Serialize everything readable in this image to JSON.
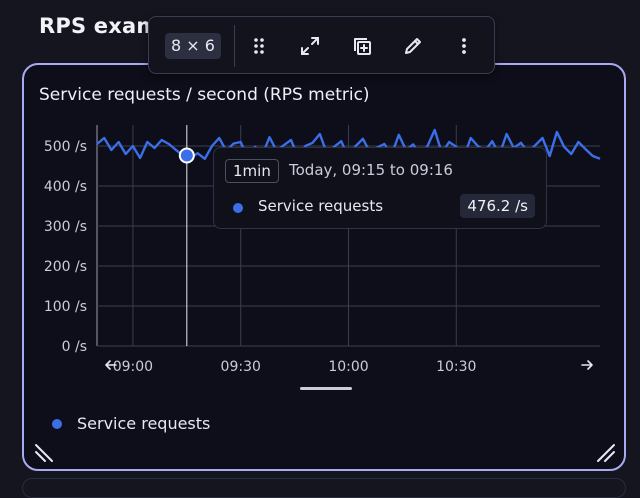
{
  "page": {
    "title": "RPS exam"
  },
  "toolbar": {
    "size": "8 × 6",
    "icons": [
      "drag-handle-icon",
      "expand-icon",
      "duplicate-icon",
      "edit-icon",
      "more-vertical-icon"
    ]
  },
  "tile": {
    "title": "Service requests / second (RPS metric)",
    "legend": {
      "label": "Service requests",
      "color": "#3a6fe8"
    }
  },
  "tooltip": {
    "interval": "1min",
    "time": "Today, 09:15 to 09:16",
    "series": "Service requests",
    "value": "476.2 /s"
  },
  "colors": {
    "series": "#3a6fe8",
    "accent_border": "#a9abf0",
    "background": "#0d0e19"
  },
  "chart_data": {
    "type": "line",
    "ylim": [
      0,
      500
    ],
    "y_ticks": [
      "500 /s",
      "400 /s",
      "300 /s",
      "200 /s",
      "100 /s",
      "0 /s"
    ],
    "y_tick_values": [
      500,
      400,
      300,
      200,
      100,
      0
    ],
    "x_ticks": [
      "09:00",
      "09:30",
      "10:00",
      "10:30"
    ],
    "x_tick_minutes": [
      540,
      570,
      600,
      630
    ],
    "x_range_minutes": [
      530,
      670
    ],
    "series": [
      {
        "color": "#3a6fe8",
        "x": [
          530,
          532,
          534,
          536,
          538,
          540,
          542,
          544,
          546,
          548,
          550,
          552,
          554,
          556,
          558,
          560,
          562,
          564,
          566,
          568,
          570,
          572,
          574,
          576,
          578,
          580,
          582,
          584,
          586,
          588,
          590,
          592,
          594,
          596,
          598,
          600,
          602,
          604,
          606,
          608,
          610,
          612,
          614,
          616,
          618,
          620,
          622,
          624,
          626,
          628,
          630,
          632,
          634,
          636,
          638,
          640,
          642,
          644,
          646,
          648,
          650,
          652,
          654,
          656,
          658,
          660,
          662,
          664,
          666,
          668,
          670
        ],
        "y": [
          505,
          520,
          490,
          510,
          480,
          500,
          470,
          510,
          495,
          515,
          505,
          490,
          476,
          470,
          482,
          468,
          500,
          520,
          488,
          506,
          510,
          470,
          498,
          478,
          522,
          488,
          502,
          515,
          472,
          500,
          508,
          530,
          482,
          498,
          512,
          470,
          500,
          518,
          484,
          496,
          505,
          478,
          528,
          490,
          504,
          476,
          500,
          540,
          482,
          510,
          498,
          470,
          520,
          500,
          488,
          512,
          478,
          530,
          495,
          508,
          484,
          502,
          520,
          475,
          535,
          498,
          480,
          510,
          492,
          475,
          468
        ]
      }
    ],
    "hover_point": {
      "x": 555,
      "y": 476.2
    }
  }
}
